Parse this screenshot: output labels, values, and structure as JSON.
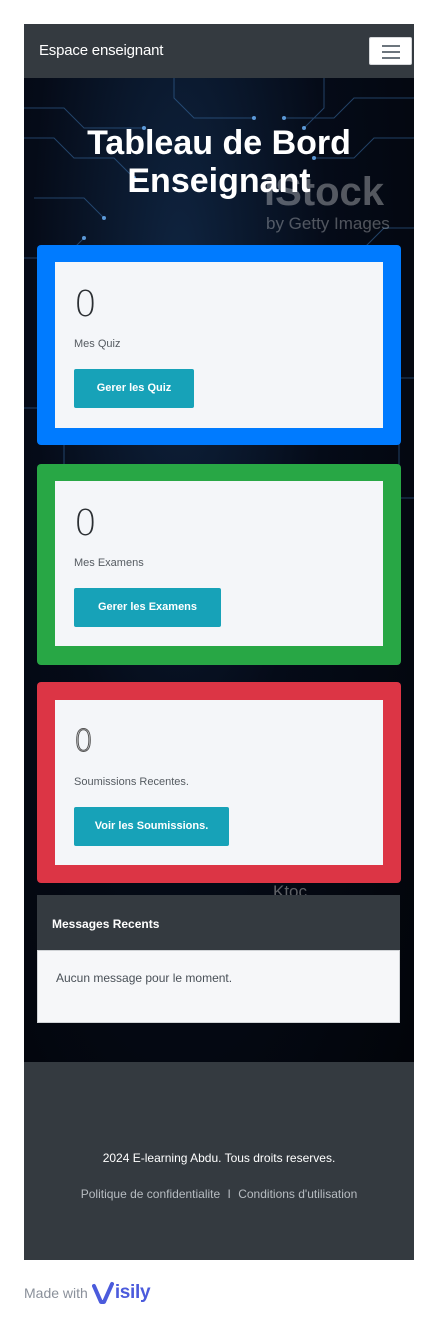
{
  "navbar": {
    "brand": "Espace enseignant",
    "toggle_icon": "hamburger-menu-icon"
  },
  "hero": {
    "title_line1": "Tableau de Bord",
    "title_line2": "Enseignant",
    "watermark": "iStock",
    "watermark_sub": "by Getty Images"
  },
  "cards": [
    {
      "count": "0",
      "label": "Mes Quiz",
      "button": "Gerer les Quiz",
      "color": "#007bff"
    },
    {
      "count": "0",
      "label": "Mes Examens",
      "button": "Gerer les Examens",
      "color": "#28a745"
    },
    {
      "count": "0",
      "label": "Soumissions Recentes.",
      "button": "Voir les Soumissions.",
      "color": "#dc3545"
    }
  ],
  "floating_text": "Ktoc",
  "messages": {
    "header": "Messages Recents",
    "empty": "Aucun message pour le moment."
  },
  "footer": {
    "copyright": "2024 E-learning Abdu. Tous droits reserves.",
    "privacy": "Politique de confidentialite",
    "separator": "I",
    "terms": "Conditions d'utilisation"
  },
  "made_with": {
    "prefix": "Made with",
    "brand": "isily",
    "logo_icon": "visily-logo-icon"
  },
  "colors": {
    "navbar": "#343a40",
    "button": "#17a2b8",
    "background": "#04070e"
  }
}
